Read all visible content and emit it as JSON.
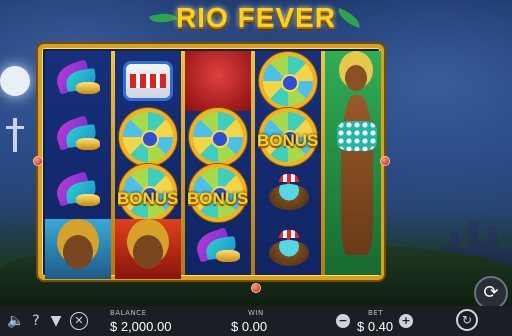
{
  "game": {
    "title": "RIO FEVER"
  },
  "reels": {
    "bonus_label": "BONUS",
    "symbols": [
      [
        "feather-mask",
        "feather-mask",
        "feather-mask",
        "blue-dancer-portrait"
      ],
      [
        "drum",
        "bonus-wheel",
        "bonus-wheel",
        "headdress-dancer-portrait"
      ],
      [
        "red-costume",
        "bonus-wheel",
        "bonus-wheel",
        "feather-mask"
      ],
      [
        "bonus-wheel",
        "bonus-wheel",
        "coconut-drink",
        "coconut-drink"
      ],
      [
        "green-dancer-expanded"
      ]
    ]
  },
  "bottom_bar": {
    "balance_label": "BALANCE",
    "balance_value": "$ 2,000.00",
    "win_label": "WIN",
    "win_value": "$ 0.00",
    "bet_label": "BET",
    "bet_value": "$ 0.40",
    "decrease_symbol": "−",
    "increase_symbol": "+",
    "icons": [
      "speaker-icon",
      "help-icon",
      "paytable-icon",
      "close-icon",
      "autoplay-icon",
      "spin-icon"
    ]
  },
  "colors": {
    "accent": "#ffd21a",
    "frame": "#d8a21c",
    "bar": "#1b1e24"
  }
}
